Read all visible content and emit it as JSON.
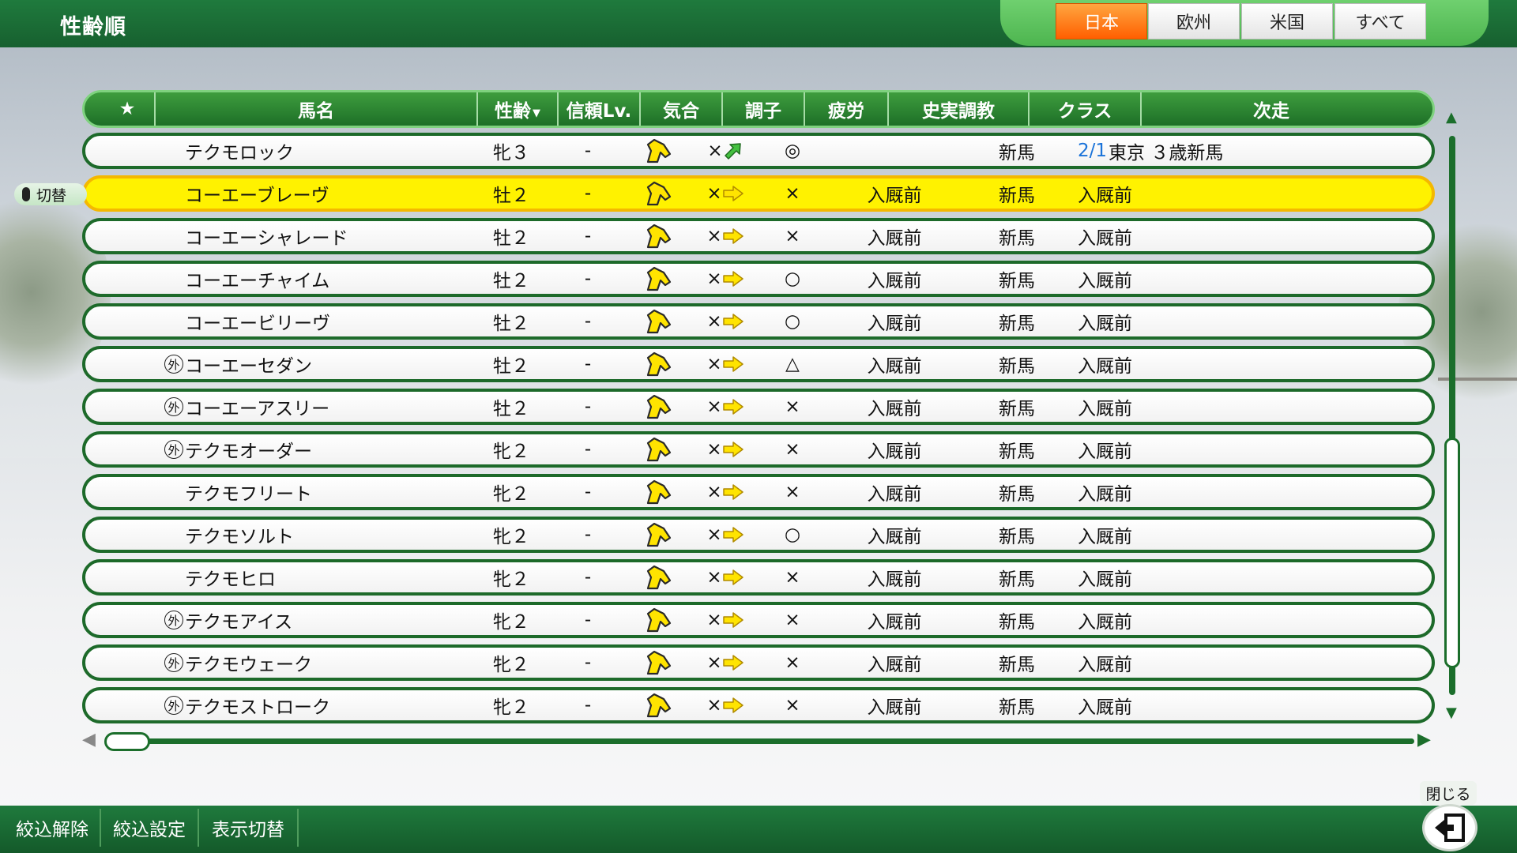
{
  "header": {
    "title": "性齢順",
    "regions": [
      {
        "label": "日本",
        "active": true
      },
      {
        "label": "欧州",
        "active": false
      },
      {
        "label": "米国",
        "active": false
      },
      {
        "label": "すべて",
        "active": false
      }
    ]
  },
  "table": {
    "columns": [
      "★",
      "馬名",
      "性齢",
      "信頼Lv.",
      "気合",
      "調子",
      "疲労",
      "史実調教",
      "クラス",
      "次走"
    ],
    "rows": [
      {
        "prefix": "",
        "name": "テクモロック",
        "sex_age": "牝３",
        "trust": "-",
        "condition_arrow": "up",
        "fatigue": "◎",
        "historical": "",
        "class": "新馬",
        "next_date": "2/1",
        "next_race": "東京 ３歳新馬",
        "selected": false
      },
      {
        "prefix": "",
        "name": "コーエーブレーヴ",
        "sex_age": "牡２",
        "trust": "-",
        "condition_arrow": "flat",
        "fatigue": "×",
        "historical": "入厩前",
        "class": "新馬",
        "next_date": "",
        "next_race": "入厩前",
        "selected": true
      },
      {
        "prefix": "",
        "name": "コーエーシャレード",
        "sex_age": "牡２",
        "trust": "-",
        "condition_arrow": "flat",
        "fatigue": "×",
        "historical": "入厩前",
        "class": "新馬",
        "next_date": "",
        "next_race": "入厩前",
        "selected": false
      },
      {
        "prefix": "",
        "name": "コーエーチャイム",
        "sex_age": "牡２",
        "trust": "-",
        "condition_arrow": "flat",
        "fatigue": "○",
        "historical": "入厩前",
        "class": "新馬",
        "next_date": "",
        "next_race": "入厩前",
        "selected": false
      },
      {
        "prefix": "",
        "name": "コーエービリーヴ",
        "sex_age": "牡２",
        "trust": "-",
        "condition_arrow": "flat",
        "fatigue": "○",
        "historical": "入厩前",
        "class": "新馬",
        "next_date": "",
        "next_race": "入厩前",
        "selected": false
      },
      {
        "prefix": "外",
        "name": "コーエーセダン",
        "sex_age": "牡２",
        "trust": "-",
        "condition_arrow": "flat",
        "fatigue": "△",
        "historical": "入厩前",
        "class": "新馬",
        "next_date": "",
        "next_race": "入厩前",
        "selected": false
      },
      {
        "prefix": "外",
        "name": "コーエーアスリー",
        "sex_age": "牡２",
        "trust": "-",
        "condition_arrow": "flat",
        "fatigue": "×",
        "historical": "入厩前",
        "class": "新馬",
        "next_date": "",
        "next_race": "入厩前",
        "selected": false
      },
      {
        "prefix": "外",
        "name": "テクモオーダー",
        "sex_age": "牝２",
        "trust": "-",
        "condition_arrow": "flat",
        "fatigue": "×",
        "historical": "入厩前",
        "class": "新馬",
        "next_date": "",
        "next_race": "入厩前",
        "selected": false
      },
      {
        "prefix": "",
        "name": "テクモフリート",
        "sex_age": "牝２",
        "trust": "-",
        "condition_arrow": "flat",
        "fatigue": "×",
        "historical": "入厩前",
        "class": "新馬",
        "next_date": "",
        "next_race": "入厩前",
        "selected": false
      },
      {
        "prefix": "",
        "name": "テクモソルト",
        "sex_age": "牝２",
        "trust": "-",
        "condition_arrow": "flat",
        "fatigue": "○",
        "historical": "入厩前",
        "class": "新馬",
        "next_date": "",
        "next_race": "入厩前",
        "selected": false
      },
      {
        "prefix": "",
        "name": "テクモヒロ",
        "sex_age": "牝２",
        "trust": "-",
        "condition_arrow": "flat",
        "fatigue": "×",
        "historical": "入厩前",
        "class": "新馬",
        "next_date": "",
        "next_race": "入厩前",
        "selected": false
      },
      {
        "prefix": "外",
        "name": "テクモアイス",
        "sex_age": "牝２",
        "trust": "-",
        "condition_arrow": "flat",
        "fatigue": "×",
        "historical": "入厩前",
        "class": "新馬",
        "next_date": "",
        "next_race": "入厩前",
        "selected": false
      },
      {
        "prefix": "外",
        "name": "テクモウェーク",
        "sex_age": "牝２",
        "trust": "-",
        "condition_arrow": "flat",
        "fatigue": "×",
        "historical": "入厩前",
        "class": "新馬",
        "next_date": "",
        "next_race": "入厩前",
        "selected": false
      },
      {
        "prefix": "外",
        "name": "テクモストローク",
        "sex_age": "牝２",
        "trust": "-",
        "condition_arrow": "flat",
        "fatigue": "×",
        "historical": "入厩前",
        "class": "新馬",
        "next_date": "",
        "next_race": "入厩前",
        "selected": false
      }
    ],
    "condition_prefix": "×",
    "switch_label": "切替"
  },
  "footer": {
    "buttons": [
      "絞込解除",
      "絞込設定",
      "表示切替"
    ],
    "close_label": "閉じる"
  },
  "colors": {
    "green_dark": "#1d6a2a",
    "selected_row": "#fff200",
    "active_tab": "#ff7a10",
    "arrow_yellow": "#ffe400",
    "arrow_up_green": "#44c040",
    "date_blue": "#1a73d9"
  },
  "icons": {
    "spirit": "horse-head-icon",
    "condition_flat": "arrow-right-icon",
    "condition_up": "arrow-up-right-icon",
    "close": "exit-door-icon",
    "switch": "mouse-icon"
  }
}
